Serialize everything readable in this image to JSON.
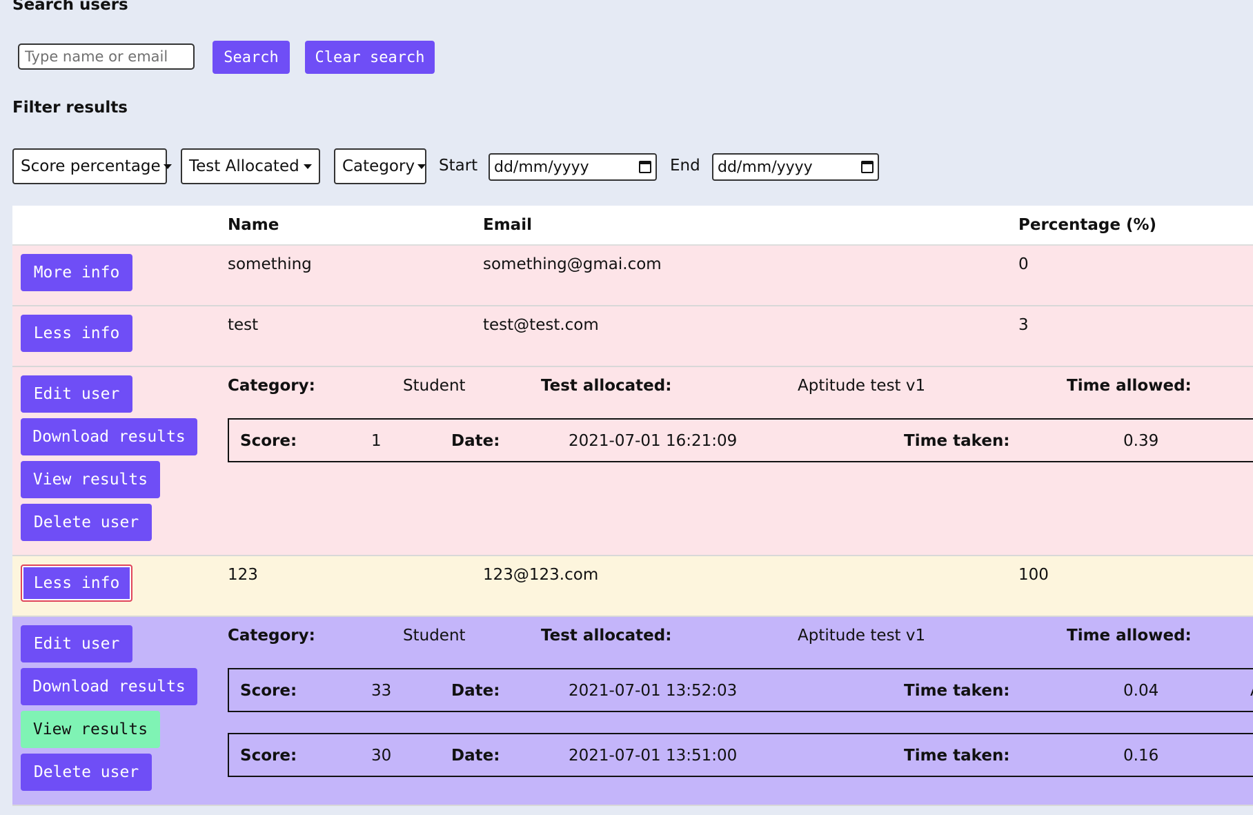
{
  "search": {
    "heading": "Search users",
    "placeholder": "Type name or email",
    "search_button": "Search",
    "clear_button": "Clear search"
  },
  "filter": {
    "heading": "Filter results",
    "score_select": "Score percentage",
    "test_select": "Test Allocated",
    "category_select": "Category",
    "start_label": "Start",
    "end_label": "End",
    "start_value": "dd/mm/yyyy",
    "end_value": "dd/mm/yyyy"
  },
  "table": {
    "headers": {
      "name": "Name",
      "email": "Email",
      "percentage": "Percentage (%)"
    },
    "rows": [
      {
        "button": "More info",
        "name": "something",
        "email": "something@gmai.com",
        "percentage": "0"
      },
      {
        "button": "Less info",
        "name": "test",
        "email": "test@test.com",
        "percentage": "3"
      },
      {
        "button": "Less info",
        "name": "123",
        "email": "123@123.com",
        "percentage": "100"
      }
    ],
    "details": [
      {
        "category_label": "Category:",
        "category": "Student",
        "test_label": "Test allocated:",
        "test": "Aptitude test v1",
        "time_allowed_label": "Time allowed:",
        "actions": [
          "Edit user",
          "Download results",
          "View results",
          "Delete user"
        ],
        "attempts": [
          {
            "score_label": "Score:",
            "score": "1",
            "date_label": "Date:",
            "date": "2021-07-01 16:21:09",
            "time_label": "Time taken:",
            "time": "0.39"
          }
        ]
      },
      {
        "category_label": "Category:",
        "category": "Student",
        "test_label": "Test allocated:",
        "test": "Aptitude test v1",
        "time_allowed_label": "Time allowed:",
        "actions": [
          "Edit user",
          "Download results",
          "View results",
          "Delete user"
        ],
        "attempts": [
          {
            "score_label": "Score:",
            "score": "33",
            "date_label": "Date:",
            "date": "2021-07-01 13:52:03",
            "time_label": "Time taken:",
            "time": "0.04",
            "extra": "A"
          },
          {
            "score_label": "Score:",
            "score": "30",
            "date_label": "Date:",
            "date": "2021-07-01 13:51:00",
            "time_label": "Time taken:",
            "time": "0.16"
          }
        ]
      }
    ]
  },
  "colors": {
    "background": "#e5eaf4",
    "accent": "#6f4ef6",
    "row_pink": "#fde4e8",
    "row_cream": "#fdf5dd",
    "row_lilac": "#c4b5fa",
    "active_green": "#7ff3b4"
  }
}
